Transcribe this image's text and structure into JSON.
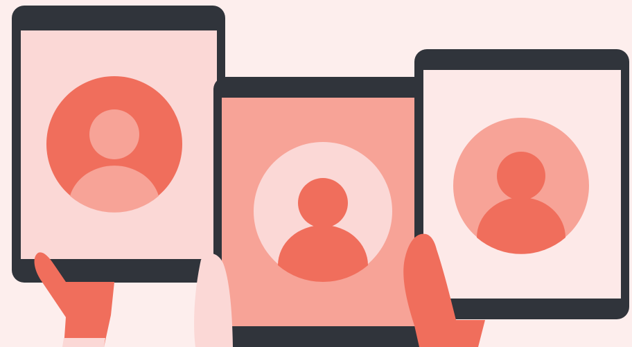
{
  "illustration": {
    "subject": "three-tablets-with-profile-avatars",
    "colors": {
      "background": "#fdeeed",
      "device_frame": "#30343b",
      "screen_light_pink": "#fbd8d6",
      "screen_salmon": "#f7a397",
      "screen_pale": "#fde9e8",
      "coral": "#f06e5c",
      "skin_light": "#fbd8d6"
    },
    "devices": [
      {
        "id": "left-tablet",
        "screen_color": "#fbd8d6",
        "avatar_circle": "#f06e5c",
        "avatar_person": "#f7a397",
        "icon": "user-avatar-icon"
      },
      {
        "id": "center-tablet",
        "screen_color": "#f7a397",
        "avatar_circle": "#fbd8d6",
        "avatar_person": "#f06e5c",
        "icon": "user-avatar-icon"
      },
      {
        "id": "right-tablet",
        "screen_color": "#fde9e8",
        "avatar_circle": "#f7a397",
        "avatar_person": "#f06e5c",
        "icon": "user-avatar-icon"
      }
    ],
    "hands": [
      "hand-icon",
      "hand-icon",
      "hand-icon"
    ]
  }
}
